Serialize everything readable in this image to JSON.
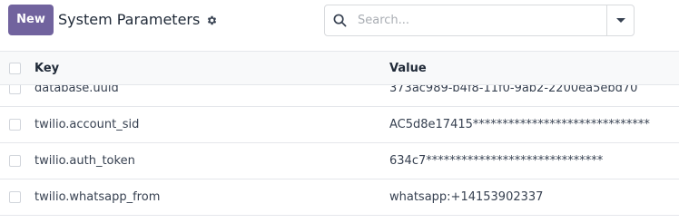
{
  "control_panel": {
    "new_button_label": "New",
    "title": "System Parameters",
    "gear_icon": "gear-icon",
    "search": {
      "placeholder": "Search...",
      "value": "",
      "icon": "search-icon"
    }
  },
  "list": {
    "columns": {
      "key": "Key",
      "value": "Value"
    },
    "rows": [
      {
        "key": "database.uuid",
        "value": "373ac989-b4f8-11f0-9ab2-2200ea5ebd70"
      },
      {
        "key": "twilio.account_sid",
        "value": "AC5d8e17415******************************"
      },
      {
        "key": "twilio.auth_token",
        "value": "634c7******************************"
      },
      {
        "key": "twilio.whatsapp_from",
        "value": "whatsapp:+14153902337"
      }
    ]
  },
  "colors": {
    "primary": "#71639e",
    "border": "#e5e7eb",
    "header_bg": "#f8f9fa"
  }
}
